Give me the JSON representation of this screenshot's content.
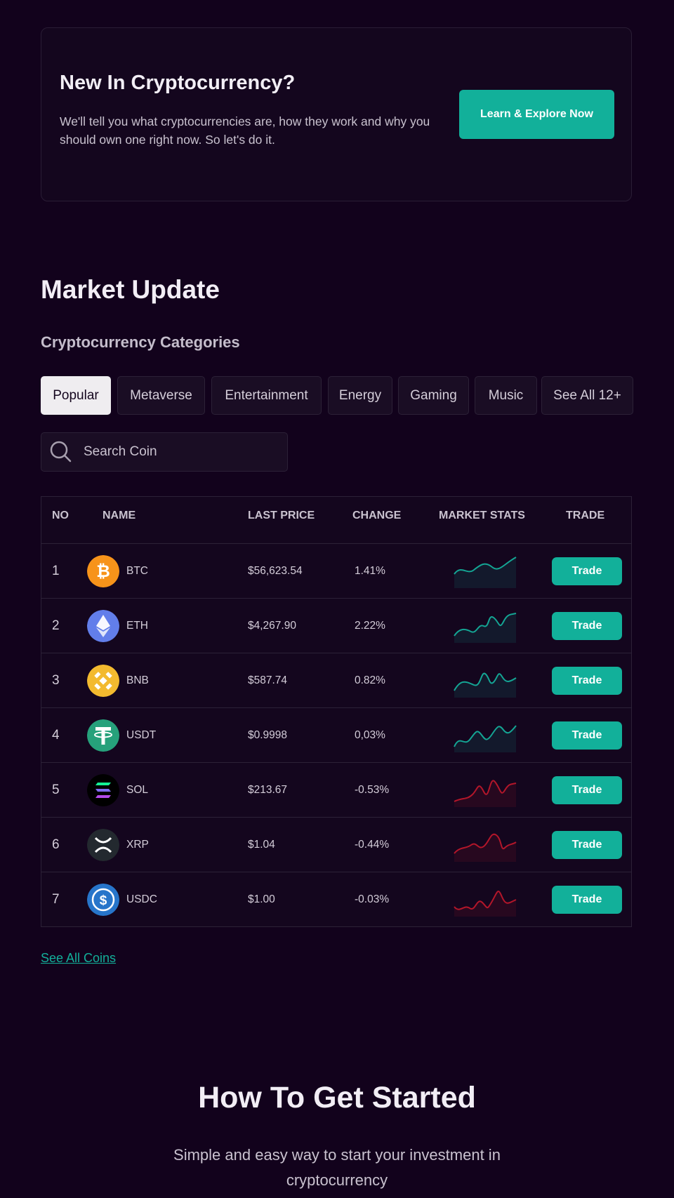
{
  "promo": {
    "title": "New In Cryptocurrency?",
    "text": "We'll tell you what cryptocurrencies are, how they work and why you should own one right now. So let's do it.",
    "button": "Learn & Explore Now"
  },
  "market": {
    "title": "Market Update",
    "subtitle": "Cryptocurrency Categories",
    "categories": [
      {
        "label": "Popular",
        "active": true
      },
      {
        "label": "Metaverse",
        "active": false
      },
      {
        "label": "Entertainment",
        "active": false
      },
      {
        "label": "Energy",
        "active": false
      },
      {
        "label": "Gaming",
        "active": false
      },
      {
        "label": "Music",
        "active": false
      },
      {
        "label": "See All 12+",
        "active": false
      }
    ],
    "search_placeholder": "Search Coin",
    "columns": [
      "NO",
      "NAME",
      "LAST PRICE",
      "CHANGE",
      "MARKET STATS",
      "TRADE"
    ],
    "rows": [
      {
        "no": "1",
        "symbol": "BTC",
        "price": "$56,623.54",
        "change": "1.41%",
        "trend": "up",
        "icon": "bitcoin-icon"
      },
      {
        "no": "2",
        "symbol": "ETH",
        "price": "$4,267.90",
        "change": "2.22%",
        "trend": "up",
        "icon": "ethereum-icon"
      },
      {
        "no": "3",
        "symbol": "BNB",
        "price": "$587.74",
        "change": "0.82%",
        "trend": "up",
        "icon": "bnb-icon"
      },
      {
        "no": "4",
        "symbol": "USDT",
        "price": "$0.9998",
        "change": "0,03%",
        "trend": "up",
        "icon": "tether-icon"
      },
      {
        "no": "5",
        "symbol": "SOL",
        "price": "$213.67",
        "change": "-0.53%",
        "trend": "down",
        "icon": "solana-icon"
      },
      {
        "no": "6",
        "symbol": "XRP",
        "price": "$1.04",
        "change": "-0.44%",
        "trend": "down",
        "icon": "xrp-icon"
      },
      {
        "no": "7",
        "symbol": "USDC",
        "price": "$1.00",
        "change": "-0.03%",
        "trend": "down",
        "icon": "usdc-icon"
      }
    ],
    "trade_label": "Trade",
    "see_all": "See All Coins"
  },
  "get_started": {
    "title": "How To Get Started",
    "text": "Simple and easy way to start your investment in cryptocurrency"
  },
  "colors": {
    "accent": "#12b09a",
    "up": "#14a594",
    "down": "#b3162a",
    "background": "#12021c"
  }
}
